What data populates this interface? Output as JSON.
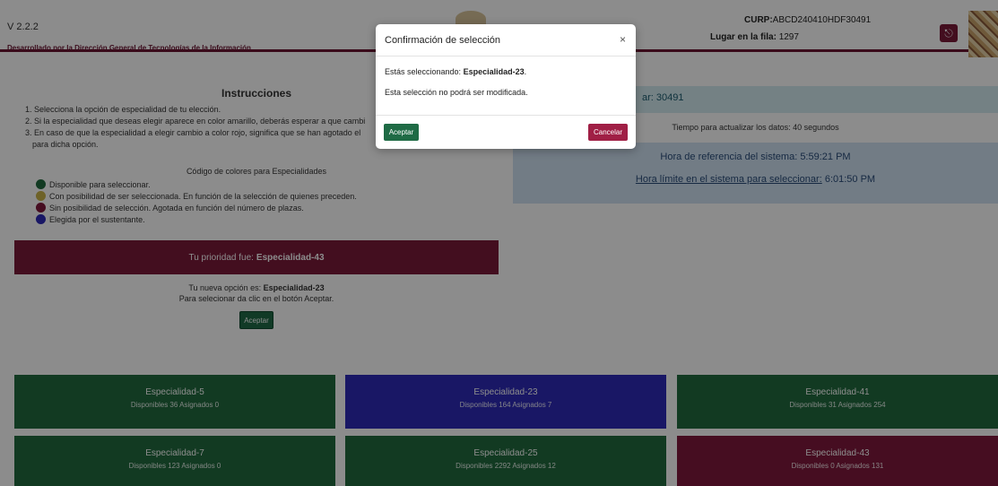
{
  "header": {
    "version": "V 2.2.2",
    "subline": "Desarrollado por la Dirección General de Tecnologías de la Información",
    "curp_label": "CURP:",
    "curp_value": "ABCD240410HDF30491",
    "fila_label": "Lugar en la fila:",
    "fila_value": "1297",
    "exit_icon": "exit-icon"
  },
  "instructions": {
    "title": "Instrucciones",
    "items": [
      "1. Selecciona la opción de especialidad de tu elección.",
      "2. Si la especialidad que deseas elegir aparece en color amarillo, deberás esperar a que cambi",
      "3. En caso de que la especialidad a elegir cambio a color rojo, significa que se han agotado el",
      "para dicha opción."
    ],
    "codigo_title": "Código de colores para Especialidades",
    "legend": [
      {
        "color": "#216b3f",
        "label": "Disponible para seleccionar."
      },
      {
        "color": "#c9b24a",
        "label": "Con posibilidad de ser seleccionada. En función de la selección de quienes preceden."
      },
      {
        "color": "#80193c",
        "label": "Sin posibilidad de selección. Agotada en función del número de plazas."
      },
      {
        "color": "#2e2bb8",
        "label": "Elegida por el sustentante."
      }
    ]
  },
  "priority": {
    "label": "Tu prioridad fue:",
    "value": "Especialidad-43"
  },
  "nueva": {
    "label": "Tu nueva opción es:",
    "value": "Especialidad-23",
    "hint": "Para selecionar da clic en el botón Aceptar.",
    "button": "Aceptar"
  },
  "status": {
    "sustentante": "ar: 30491",
    "tiempo": "Tiempo para actualizar los datos: 40 segundos",
    "hora_ref": "Hora de referencia del sistema: 5:59:21 PM",
    "hora_lim_label": "Hora límite en el sistema para seleccionar:",
    "hora_lim_value": "6:01:50 PM"
  },
  "cards": [
    {
      "name": "Especialidad-5",
      "info": "Disponibles 36 Asignados 0",
      "color": "green"
    },
    {
      "name": "Especialidad-23",
      "info": "Disponibles 164 Asignados 7",
      "color": "blue"
    },
    {
      "name": "Especialidad-41",
      "info": "Disponibles 31 Asignados 254",
      "color": "green"
    },
    {
      "name": "Especialidad-7",
      "info": "Disponibles 123 Asignados 0",
      "color": "green"
    },
    {
      "name": "Especialidad-25",
      "info": "Disponibles 2292 Asignados 12",
      "color": "green"
    },
    {
      "name": "Especialidad-43",
      "info": "Disponibles 0 Asignados 131",
      "color": "red"
    }
  ],
  "modal": {
    "title": "Confirmación de selección",
    "close": "×",
    "line1_label": "Estás seleccionando:",
    "line1_value": "Especialidad-23",
    "line2": "Esta selección no podrá ser modificada.",
    "ok": "Aceptar",
    "cancel": "Cancelar"
  }
}
